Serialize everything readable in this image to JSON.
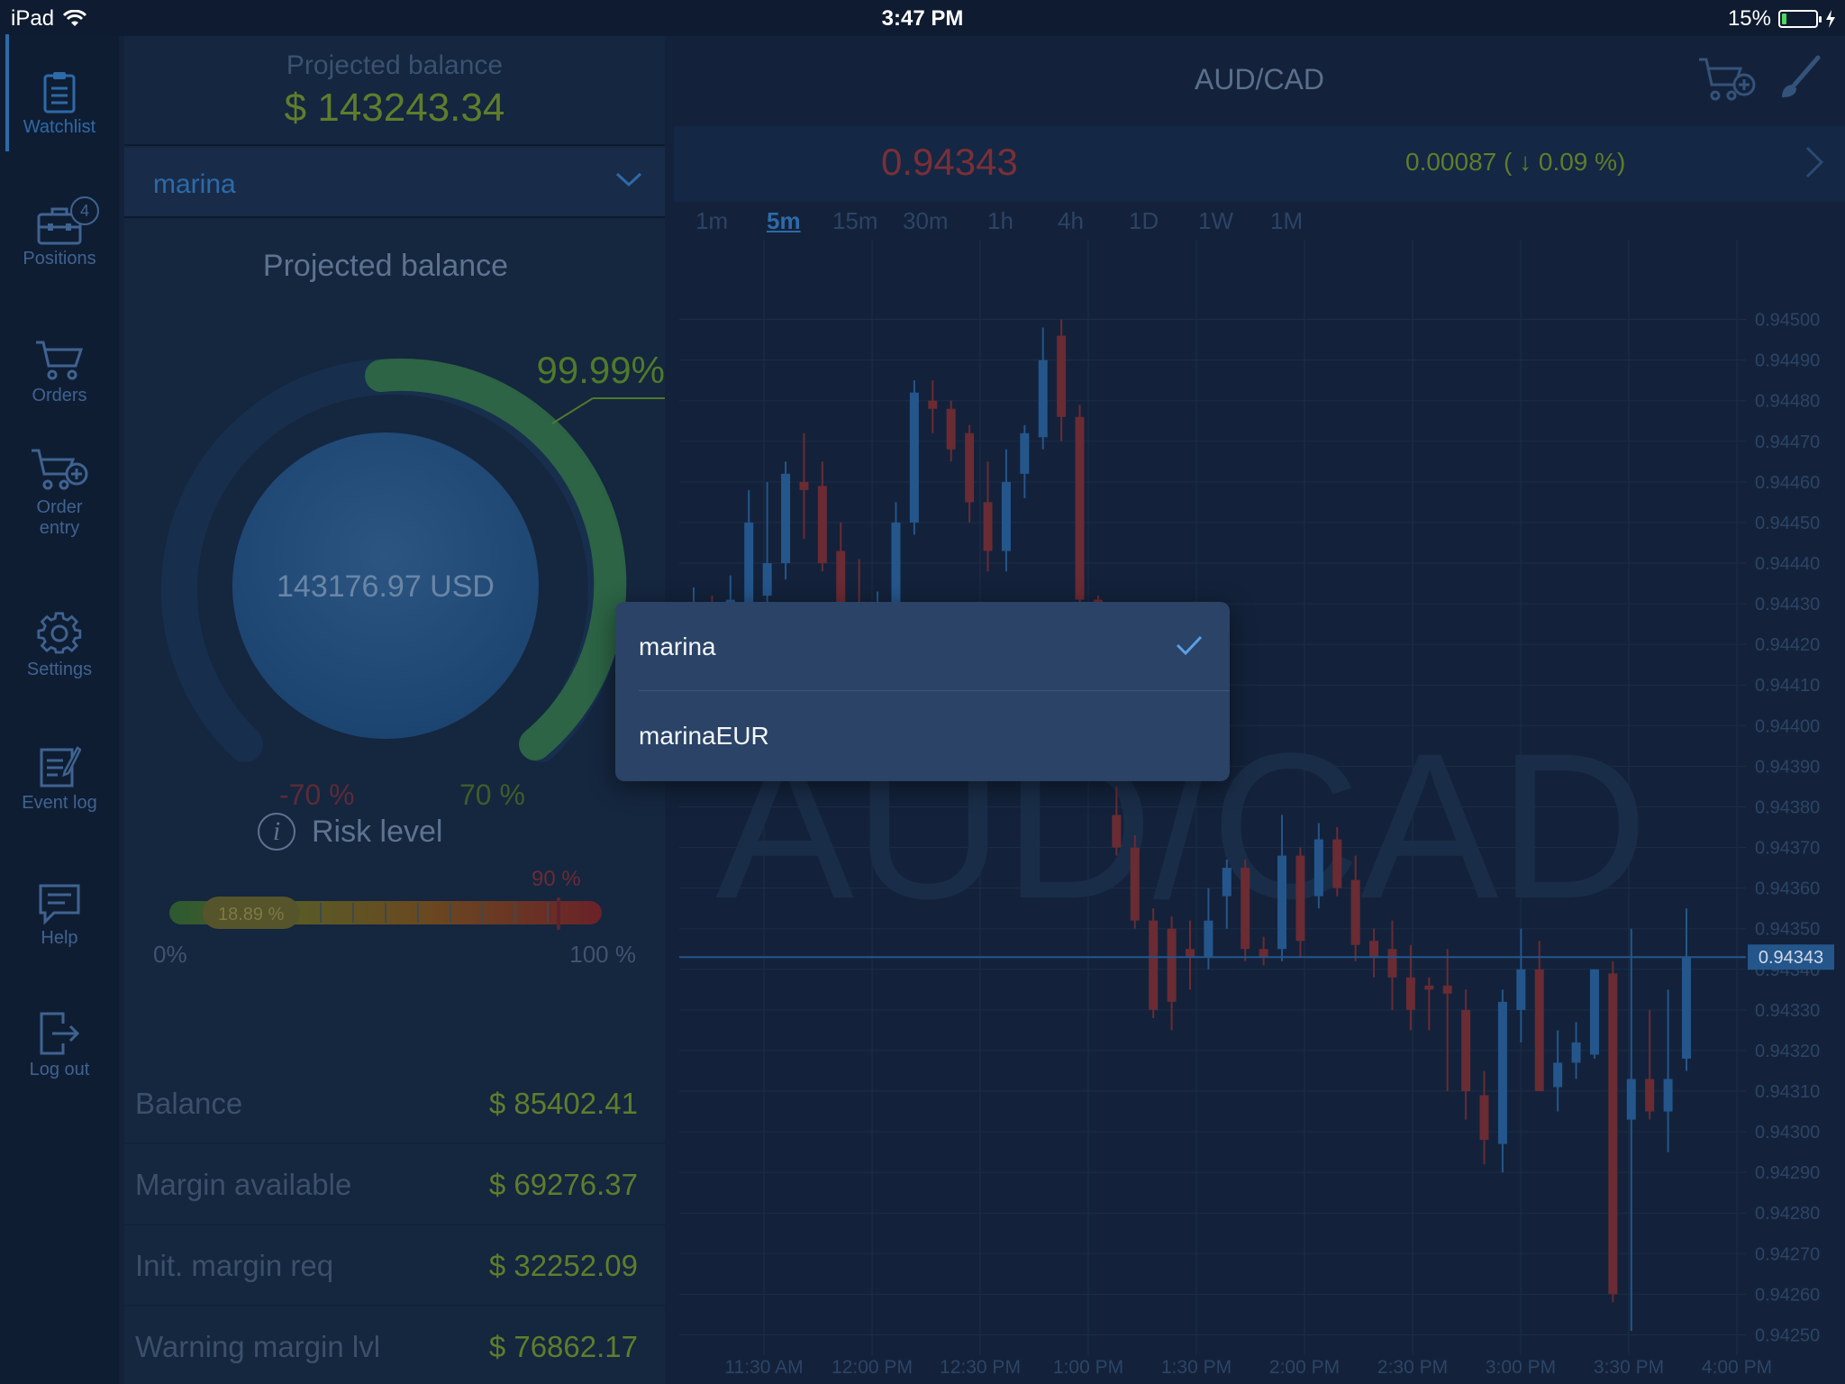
{
  "status_bar": {
    "device": "iPad",
    "time": "3:47 PM",
    "battery": "15%",
    "battery_level": 0.15
  },
  "sidebar": {
    "items": [
      {
        "label": "Watchlist",
        "icon": "clipboard-icon",
        "active": true
      },
      {
        "label": "Positions",
        "icon": "briefcase-icon",
        "badge": "4"
      },
      {
        "label": "Orders",
        "icon": "cart-icon"
      },
      {
        "label": "Order entry",
        "icon": "cart-plus-icon"
      },
      {
        "label": "Settings",
        "icon": "gear-icon"
      },
      {
        "label": "Event log",
        "icon": "log-icon"
      },
      {
        "label": "Help",
        "icon": "chat-icon"
      },
      {
        "label": "Log out",
        "icon": "logout-icon"
      }
    ]
  },
  "account": {
    "header_label": "Projected balance",
    "header_value": "$ 143243.34",
    "selected_account": "marina",
    "gauge_title": "Projected balance",
    "gauge_value": "143176.97 USD",
    "gauge_percent": "99.99%",
    "gauge_min": "-70 %",
    "gauge_max": "70 %",
    "risk_title": "Risk level",
    "risk_value": "18.89 %",
    "risk_level": 0.1889,
    "risk_warning": "90 %",
    "risk_min": "0%",
    "risk_max": "100 %",
    "stats": [
      {
        "label": "Balance",
        "value": "$ 85402.41"
      },
      {
        "label": "Margin available",
        "value": "$ 69276.37"
      },
      {
        "label": "Init. margin req",
        "value": "$ 32252.09"
      },
      {
        "label": "Warning margin lvl",
        "value": "$ 76862.17"
      }
    ]
  },
  "chart": {
    "symbol": "AUD/CAD",
    "watermark": "AUD/CAD",
    "price": "0.94343",
    "change": "0.00087 ( ↓ 0.09 %)",
    "timeframes": [
      "1m",
      "5m",
      "15m",
      "30m",
      "1h",
      "4h",
      "1D",
      "1W",
      "1M"
    ],
    "active_timeframe": "5m",
    "current_price_label": "0.94343",
    "current_price": 0.94343,
    "y_ticks": [
      "0.94500",
      "0.94490",
      "0.94480",
      "0.94470",
      "0.94460",
      "0.94450",
      "0.94440",
      "0.94430",
      "0.94420",
      "0.94410",
      "0.94400",
      "0.94390",
      "0.94380",
      "0.94370",
      "0.94360",
      "0.94350",
      "0.94340",
      "0.94330",
      "0.94320",
      "0.94310",
      "0.94300",
      "0.94290",
      "0.94280",
      "0.94270",
      "0.94260",
      "0.94250"
    ],
    "x_ticks": [
      "11:30 AM",
      "12:00 PM",
      "12:30 PM",
      "1:00 PM",
      "1:30 PM",
      "2:00 PM",
      "2:30 PM",
      "3:00 PM",
      "3:30 PM",
      "4:00 PM"
    ],
    "colors": {
      "up": "#24568c",
      "down": "#6a2b33",
      "grid": "#1b2d47"
    }
  },
  "chart_data": {
    "type": "candlestick",
    "title": "AUD/CAD",
    "ylim": [
      0.94245,
      0.94505
    ],
    "series": [
      {
        "candles": [
          {
            "o": 0.9442,
            "h": 0.94434,
            "l": 0.94415,
            "c": 0.9443
          },
          {
            "o": 0.94427,
            "h": 0.94432,
            "l": 0.94418,
            "c": 0.9442
          },
          {
            "o": 0.94418,
            "h": 0.94437,
            "l": 0.9441,
            "c": 0.94431
          },
          {
            "o": 0.9443,
            "h": 0.94458,
            "l": 0.94428,
            "c": 0.9445
          },
          {
            "o": 0.94432,
            "h": 0.9446,
            "l": 0.94426,
            "c": 0.9444
          },
          {
            "o": 0.9444,
            "h": 0.94465,
            "l": 0.94436,
            "c": 0.94462
          },
          {
            "o": 0.9446,
            "h": 0.94472,
            "l": 0.94446,
            "c": 0.94458
          },
          {
            "o": 0.94459,
            "h": 0.94465,
            "l": 0.94438,
            "c": 0.9444
          },
          {
            "o": 0.94443,
            "h": 0.9445,
            "l": 0.94425,
            "c": 0.94428
          },
          {
            "o": 0.94428,
            "h": 0.94441,
            "l": 0.94416,
            "c": 0.94418
          },
          {
            "o": 0.94418,
            "h": 0.94433,
            "l": 0.9441,
            "c": 0.94427
          },
          {
            "o": 0.9443,
            "h": 0.94455,
            "l": 0.94428,
            "c": 0.9445
          },
          {
            "o": 0.9445,
            "h": 0.94485,
            "l": 0.94447,
            "c": 0.94482
          },
          {
            "o": 0.9448,
            "h": 0.94485,
            "l": 0.94472,
            "c": 0.94478
          },
          {
            "o": 0.94478,
            "h": 0.9448,
            "l": 0.94465,
            "c": 0.94468
          },
          {
            "o": 0.94472,
            "h": 0.94474,
            "l": 0.9445,
            "c": 0.94455
          },
          {
            "o": 0.94455,
            "h": 0.94465,
            "l": 0.94438,
            "c": 0.94443
          },
          {
            "o": 0.94443,
            "h": 0.94468,
            "l": 0.94438,
            "c": 0.9446
          },
          {
            "o": 0.94462,
            "h": 0.94474,
            "l": 0.94456,
            "c": 0.94472
          },
          {
            "o": 0.94471,
            "h": 0.94498,
            "l": 0.94468,
            "c": 0.9449
          },
          {
            "o": 0.94496,
            "h": 0.945,
            "l": 0.9447,
            "c": 0.94476
          },
          {
            "o": 0.94476,
            "h": 0.94479,
            "l": 0.94425,
            "c": 0.94431
          },
          {
            "o": 0.94431,
            "h": 0.94432,
            "l": 0.9441,
            "c": 0.94412
          },
          {
            "o": 0.94378,
            "h": 0.94385,
            "l": 0.94368,
            "c": 0.9437
          },
          {
            "o": 0.9437,
            "h": 0.94373,
            "l": 0.9435,
            "c": 0.94352
          },
          {
            "o": 0.94352,
            "h": 0.94355,
            "l": 0.94328,
            "c": 0.9433
          },
          {
            "o": 0.9435,
            "h": 0.94353,
            "l": 0.94325,
            "c": 0.94332
          },
          {
            "o": 0.94345,
            "h": 0.94352,
            "l": 0.94335,
            "c": 0.94343
          },
          {
            "o": 0.94343,
            "h": 0.9436,
            "l": 0.9434,
            "c": 0.94352
          },
          {
            "o": 0.94358,
            "h": 0.94367,
            "l": 0.9435,
            "c": 0.94365
          },
          {
            "o": 0.94365,
            "h": 0.94367,
            "l": 0.94342,
            "c": 0.94345
          },
          {
            "o": 0.94345,
            "h": 0.94348,
            "l": 0.94341,
            "c": 0.94343
          },
          {
            "o": 0.94345,
            "h": 0.94378,
            "l": 0.94342,
            "c": 0.94368
          },
          {
            "o": 0.94368,
            "h": 0.9437,
            "l": 0.94343,
            "c": 0.94347
          },
          {
            "o": 0.94358,
            "h": 0.94376,
            "l": 0.94355,
            "c": 0.94372
          },
          {
            "o": 0.94372,
            "h": 0.94375,
            "l": 0.94358,
            "c": 0.9436
          },
          {
            "o": 0.94362,
            "h": 0.94368,
            "l": 0.94342,
            "c": 0.94346
          },
          {
            "o": 0.94347,
            "h": 0.9435,
            "l": 0.94338,
            "c": 0.94343
          },
          {
            "o": 0.94345,
            "h": 0.94352,
            "l": 0.9433,
            "c": 0.94338
          },
          {
            "o": 0.94338,
            "h": 0.94346,
            "l": 0.94325,
            "c": 0.9433
          },
          {
            "o": 0.94336,
            "h": 0.94338,
            "l": 0.94325,
            "c": 0.94335
          },
          {
            "o": 0.94336,
            "h": 0.94345,
            "l": 0.9431,
            "c": 0.94334
          },
          {
            "o": 0.9433,
            "h": 0.94335,
            "l": 0.94303,
            "c": 0.9431
          },
          {
            "o": 0.94309,
            "h": 0.94315,
            "l": 0.94292,
            "c": 0.94298
          },
          {
            "o": 0.94297,
            "h": 0.94335,
            "l": 0.9429,
            "c": 0.94332
          },
          {
            "o": 0.9433,
            "h": 0.9435,
            "l": 0.94322,
            "c": 0.9434
          },
          {
            "o": 0.9434,
            "h": 0.94347,
            "l": 0.9431,
            "c": 0.9431
          },
          {
            "o": 0.94311,
            "h": 0.94325,
            "l": 0.94305,
            "c": 0.94317
          },
          {
            "o": 0.94317,
            "h": 0.94327,
            "l": 0.94313,
            "c": 0.94322
          },
          {
            "o": 0.94319,
            "h": 0.9434,
            "l": 0.94318,
            "c": 0.9434
          },
          {
            "o": 0.94339,
            "h": 0.94342,
            "l": 0.94258,
            "c": 0.9426
          },
          {
            "o": 0.94303,
            "h": 0.9435,
            "l": 0.94251,
            "c": 0.94313
          },
          {
            "o": 0.94313,
            "h": 0.9433,
            "l": 0.94303,
            "c": 0.94305
          },
          {
            "o": 0.94305,
            "h": 0.94335,
            "l": 0.94295,
            "c": 0.94313
          },
          {
            "o": 0.94318,
            "h": 0.94355,
            "l": 0.94315,
            "c": 0.94343
          }
        ]
      }
    ],
    "y_ticks": [
      0.945,
      0.9449,
      0.9448,
      0.9447,
      0.9446,
      0.9445,
      0.9444,
      0.9443,
      0.9442,
      0.9441,
      0.944,
      0.9439,
      0.9438,
      0.9437,
      0.9436,
      0.9435,
      0.9434,
      0.9433,
      0.9432,
      0.9431,
      0.943,
      0.9429,
      0.9428,
      0.9427,
      0.9426,
      0.9425
    ],
    "x_ticks": [
      "11:30 AM",
      "12:00 PM",
      "12:30 PM",
      "1:00 PM",
      "1:30 PM",
      "2:00 PM",
      "2:30 PM",
      "3:00 PM",
      "3:30 PM",
      "4:00 PM"
    ],
    "current_price": 0.94343
  },
  "dropdown": {
    "items": [
      {
        "label": "marina",
        "selected": true
      },
      {
        "label": "marinaEUR",
        "selected": false
      }
    ]
  }
}
